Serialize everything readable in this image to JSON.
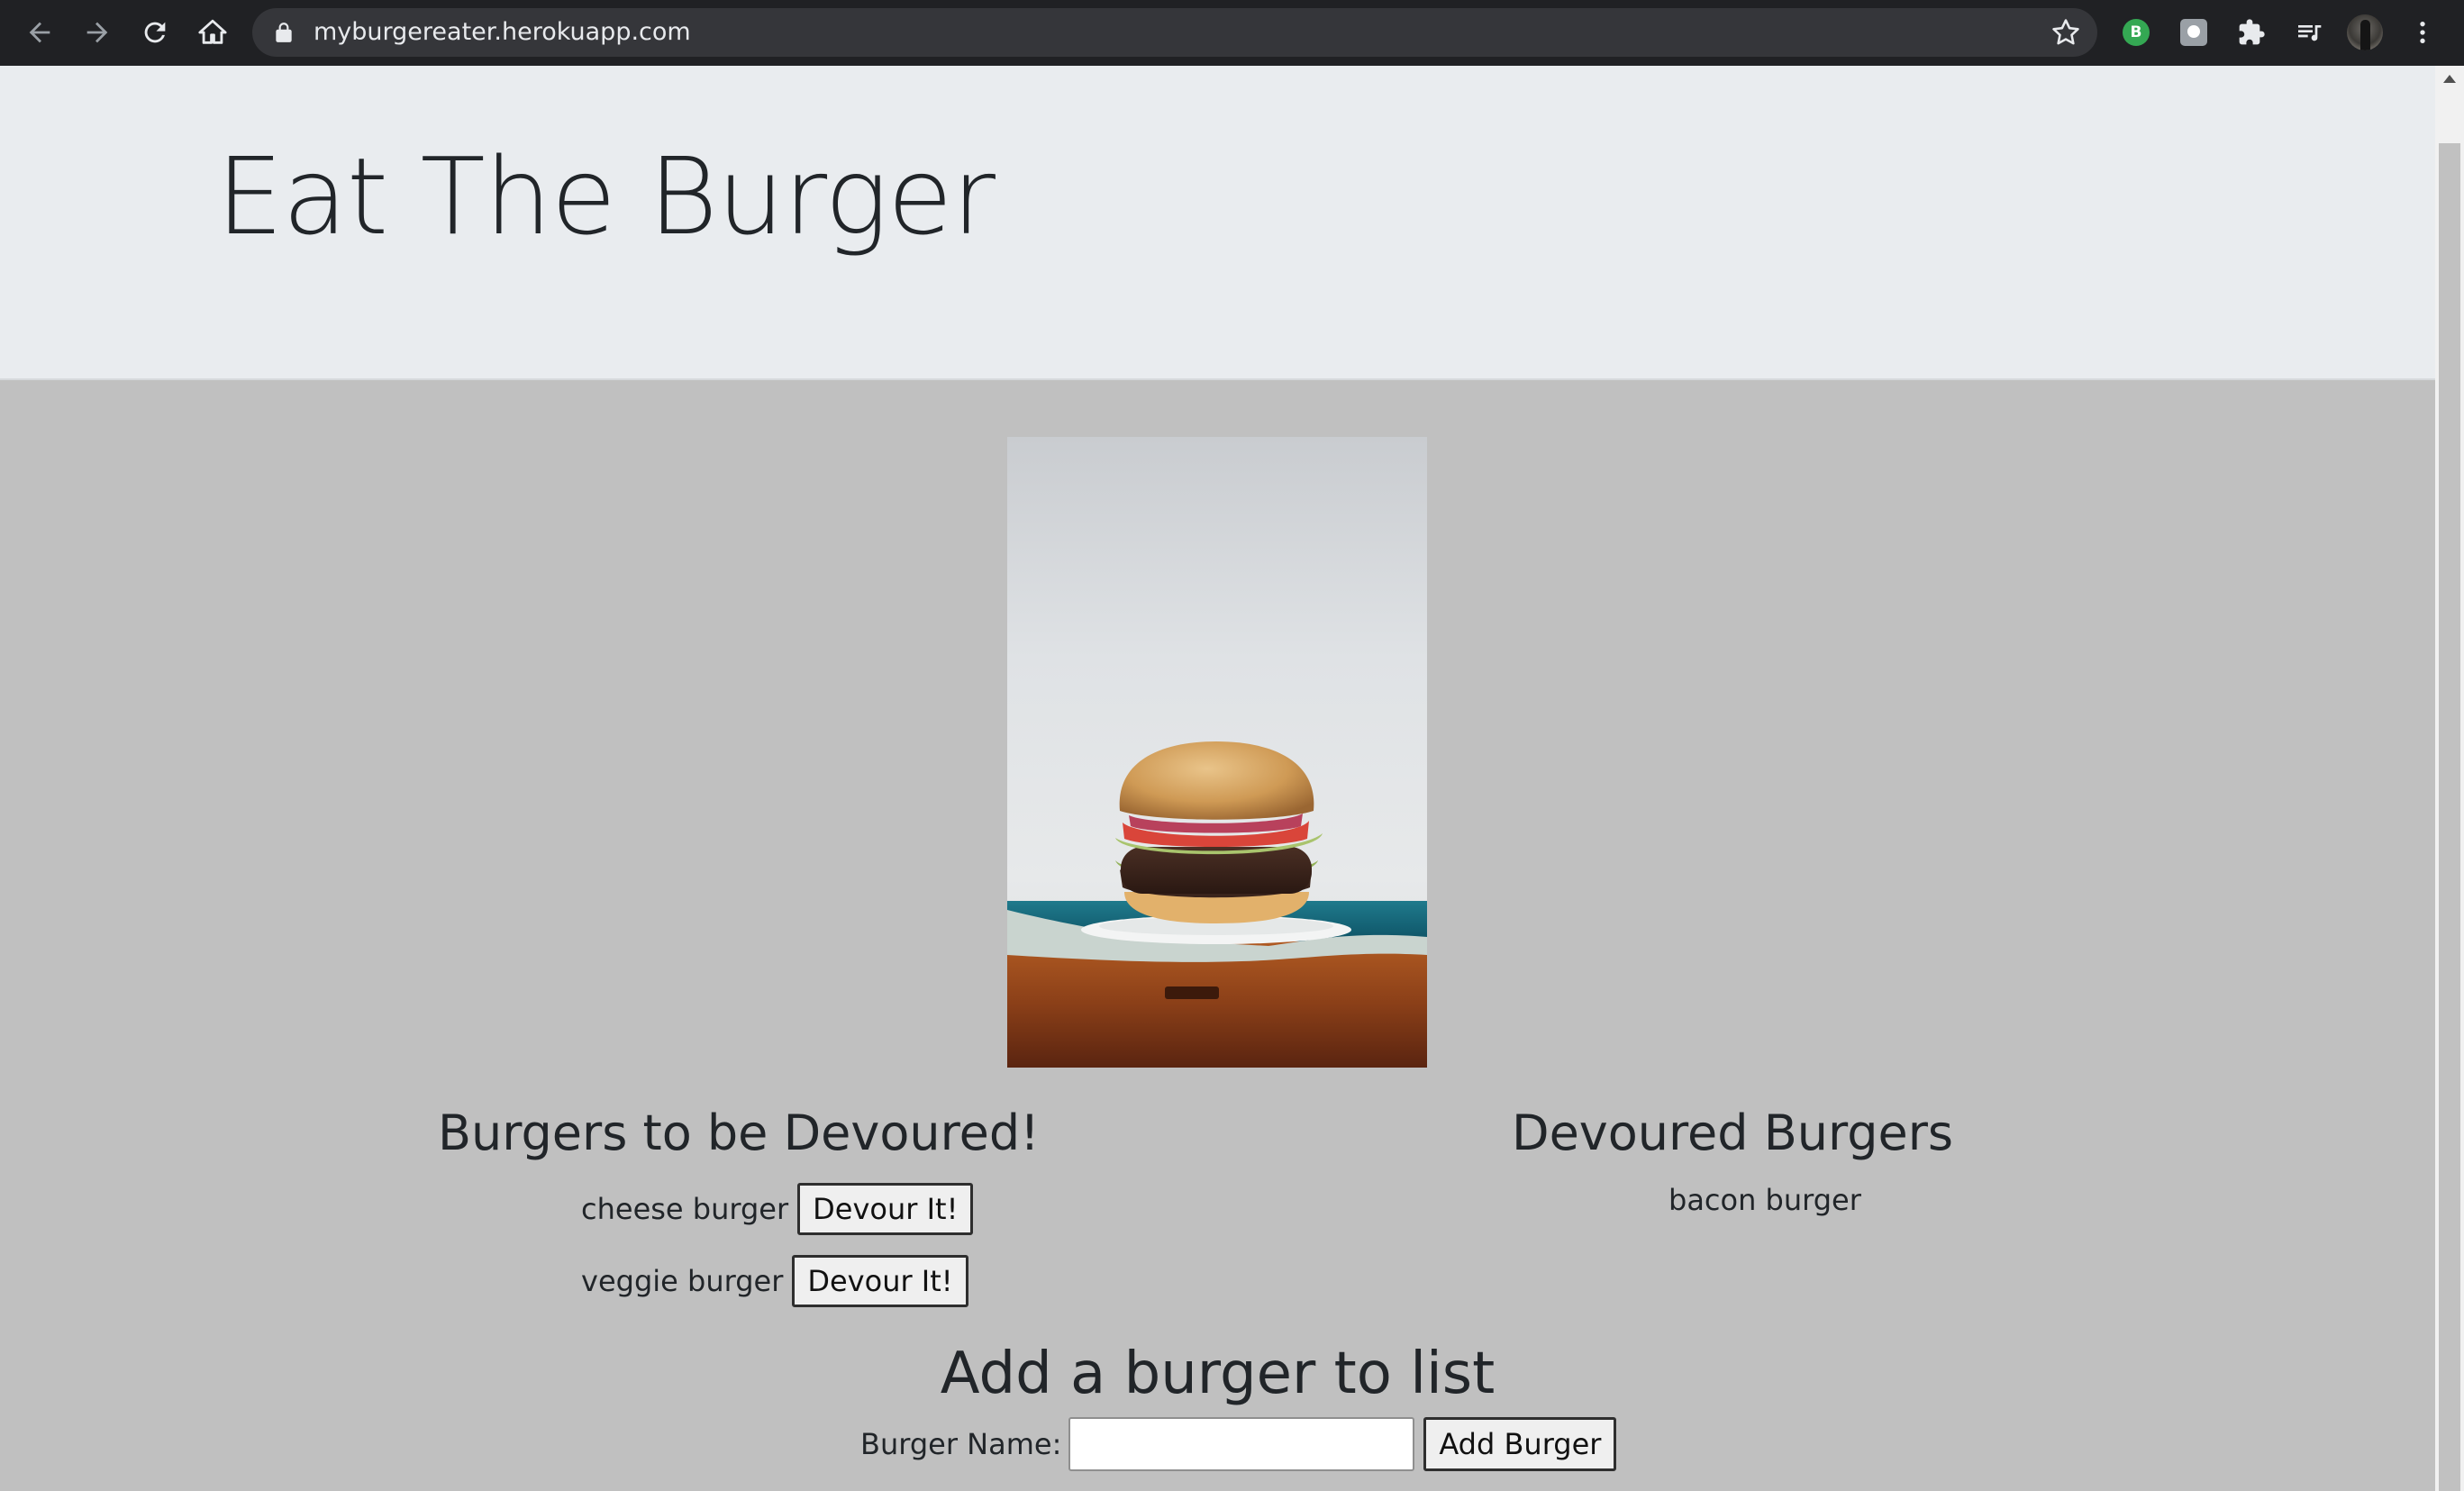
{
  "browser": {
    "url": "myburgereater.herokuapp.com",
    "extension_badge": "B",
    "icons": {
      "back": "back-arrow-icon",
      "forward": "forward-arrow-icon",
      "reload": "reload-icon",
      "home": "home-icon",
      "lock": "lock-icon",
      "bookmark": "star-icon",
      "extensions": "puzzle-icon",
      "media": "playlist-icon",
      "menu": "kebab-menu-icon"
    }
  },
  "page": {
    "title": "Eat The Burger",
    "photo": "burger-photo",
    "to_devour": {
      "heading": "Burgers to be Devoured!",
      "items": [
        {
          "name": "cheese burger",
          "button": "Devour It!"
        },
        {
          "name": "veggie burger",
          "button": "Devour It!"
        }
      ]
    },
    "devoured": {
      "heading": "Devoured Burgers",
      "items": [
        {
          "name": "bacon burger"
        }
      ]
    },
    "add_form": {
      "heading": "Add a burger to list",
      "label": "Burger Name:",
      "input_value": "",
      "button": "Add Burger"
    }
  },
  "colors": {
    "chrome_bg": "#202124",
    "omnibox_bg": "#35363a",
    "jumbotron_bg": "#e9ecef",
    "page_bg": "#c0c0c0",
    "text": "#212529"
  }
}
